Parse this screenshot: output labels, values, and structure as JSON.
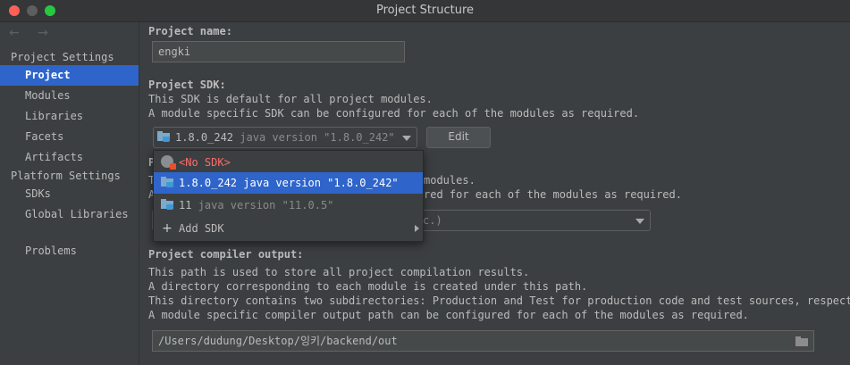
{
  "window": {
    "title": "Project Structure"
  },
  "sidebar": {
    "nav_arrows": "← →",
    "project_settings_header": "Project Settings",
    "project_settings_items": [
      {
        "label": "Project",
        "selected": true
      },
      {
        "label": "Modules"
      },
      {
        "label": "Libraries"
      },
      {
        "label": "Facets"
      },
      {
        "label": "Artifacts"
      }
    ],
    "platform_settings_header": "Platform Settings",
    "platform_settings_items": [
      {
        "label": "SDKs"
      },
      {
        "label": "Global Libraries"
      }
    ],
    "problems_label": "Problems"
  },
  "project_name": {
    "label": "Project name:",
    "value": "engki"
  },
  "project_sdk": {
    "label": "Project SDK:",
    "desc_line1": "This SDK is default for all project modules.",
    "desc_line2": "A module specific SDK can be configured for each of the modules as required.",
    "selected_version": "1.8.0_242",
    "selected_detail": "java version \"1.8.0_242\"",
    "edit_button": "Edit"
  },
  "project_language_level": {
    "label_fragment": "P",
    "desc_line1_start": "T",
    "desc_line1_end": "modules.",
    "desc_line2_start": "A",
    "desc_line2_end": "red for each of the modules as required.",
    "select_fragment": "c.)"
  },
  "sdk_dropdown": {
    "items": [
      {
        "label": "<No SDK>"
      },
      {
        "name": "1.8.0_242",
        "detail": "java version \"1.8.0_242\"",
        "selected": true
      },
      {
        "name": "11",
        "detail": "java version \"11.0.5\""
      },
      {
        "label": "Add SDK"
      }
    ]
  },
  "compiler_output": {
    "label": "Project compiler output:",
    "desc_lines": [
      "This path is used to store all project compilation results.",
      "A directory corresponding to each module is created under this path.",
      "This directory contains two subdirectories: Production and Test for production code and test sources, respectively.",
      "A module specific compiler output path can be configured for each of the modules as required."
    ],
    "path": "/Users/dudung/Desktop/잉키/backend/out"
  },
  "colors": {
    "background": "#3c3f41",
    "selection": "#2f65ca",
    "error_text": "#ff6b68"
  }
}
